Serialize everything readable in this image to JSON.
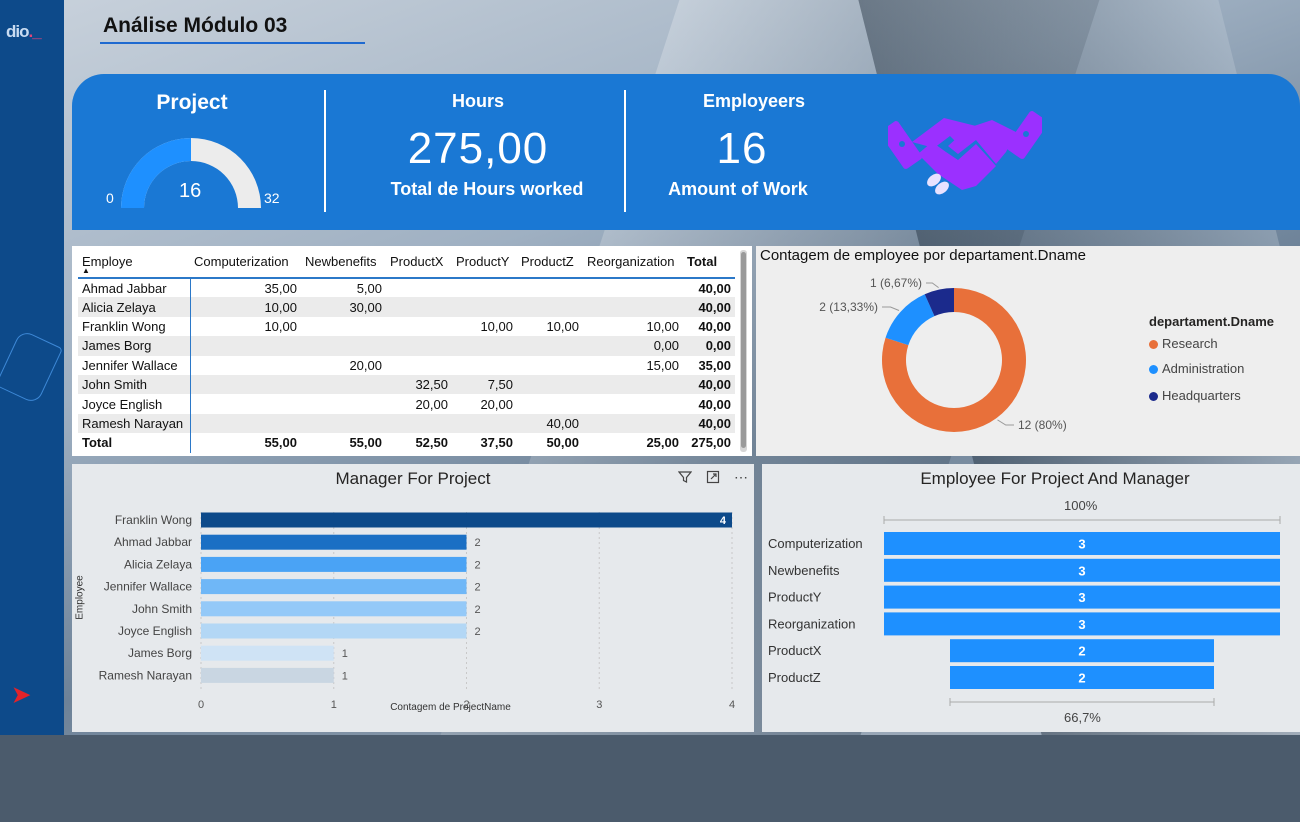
{
  "brand": {
    "logo_text": "dio",
    "logo_accent": "._"
  },
  "page_title": "Análise Módulo 03",
  "kpis": {
    "project": {
      "label": "Project",
      "value": "16",
      "min": "0",
      "max": "32",
      "fraction": 0.5
    },
    "hours": {
      "label": "Hours",
      "value": "275,00",
      "caption": "Total de Hours worked"
    },
    "employees": {
      "label": "Employeers",
      "value": "16",
      "caption": "Amount of Work"
    },
    "icon": "handshake-icon"
  },
  "matrix": {
    "columns": [
      "Employe",
      "Computerization",
      "Newbenefits",
      "ProductX",
      "ProductY",
      "ProductZ",
      "Reorganization",
      "Total"
    ],
    "rows": [
      [
        "Ahmad Jabbar",
        "35,00",
        "5,00",
        "",
        "",
        "",
        "",
        "40,00"
      ],
      [
        "Alicia Zelaya",
        "10,00",
        "30,00",
        "",
        "",
        "",
        "",
        "40,00"
      ],
      [
        "Franklin Wong",
        "10,00",
        "",
        "",
        "10,00",
        "10,00",
        "10,00",
        "40,00"
      ],
      [
        "James Borg",
        "",
        "",
        "",
        "",
        "",
        "0,00",
        "0,00"
      ],
      [
        "Jennifer Wallace",
        "",
        "20,00",
        "",
        "",
        "",
        "15,00",
        "35,00"
      ],
      [
        "John Smith",
        "",
        "",
        "32,50",
        "7,50",
        "",
        "",
        "40,00"
      ],
      [
        "Joyce English",
        "",
        "",
        "20,00",
        "20,00",
        "",
        "",
        "40,00"
      ],
      [
        "Ramesh Narayan",
        "",
        "",
        "",
        "",
        "40,00",
        "",
        "40,00"
      ]
    ],
    "total_row": [
      "Total",
      "55,00",
      "55,00",
      "52,50",
      "37,50",
      "50,00",
      "25,00",
      "275,00"
    ]
  },
  "chart_data": [
    {
      "type": "pie",
      "title": "Contagem de employee por departament.Dname",
      "legend_title": "departament.Dname",
      "legend_position": "right",
      "slices": [
        {
          "label": "Research",
          "value": 12,
          "data_label": "12 (80%)",
          "color": "#e8703a"
        },
        {
          "label": "Administration",
          "value": 2,
          "data_label": "2 (13,33%)",
          "color": "#1e90ff"
        },
        {
          "label": "Headquarters",
          "value": 1,
          "data_label": "1 (6,67%)",
          "color": "#1b2a8c"
        }
      ]
    },
    {
      "type": "bar",
      "orientation": "horizontal",
      "title": "Manager For Project",
      "xlabel": "Contagem de ProjectName",
      "ylabel": "Employee",
      "xlim": [
        0,
        4
      ],
      "xticks": [
        "0",
        "1",
        "2",
        "3",
        "4"
      ],
      "categories": [
        "Franklin Wong",
        "Ahmad Jabbar",
        "Alicia Zelaya",
        "Jennifer Wallace",
        "John Smith",
        "Joyce English",
        "James Borg",
        "Ramesh Narayan"
      ],
      "values": [
        4,
        2,
        2,
        2,
        2,
        2,
        1,
        1
      ],
      "colors": [
        "#0d4a8a",
        "#1a6fc4",
        "#4aa3f5",
        "#6fb7f7",
        "#94c9f8",
        "#b3d7f5",
        "#cfe3f5",
        "#c9d6e2"
      ]
    },
    {
      "type": "bar",
      "orientation": "horizontal",
      "subtype": "funnel",
      "title": "Employee For Project And Manager",
      "top_label": "100%",
      "bottom_label": "66,7%",
      "categories": [
        "Computerization",
        "Newbenefits",
        "ProductY",
        "Reorganization",
        "ProductX",
        "ProductZ"
      ],
      "values": [
        3,
        3,
        3,
        3,
        2,
        2
      ],
      "color": "#1e90ff"
    }
  ],
  "visual_header_icons": [
    "filter-icon",
    "focus-mode-icon",
    "more-options-icon"
  ],
  "colors": {
    "rail": "#0d4a8a",
    "banner": "#1a78d4",
    "accent": "#1e90ff",
    "handshake": "#9b30ff"
  }
}
